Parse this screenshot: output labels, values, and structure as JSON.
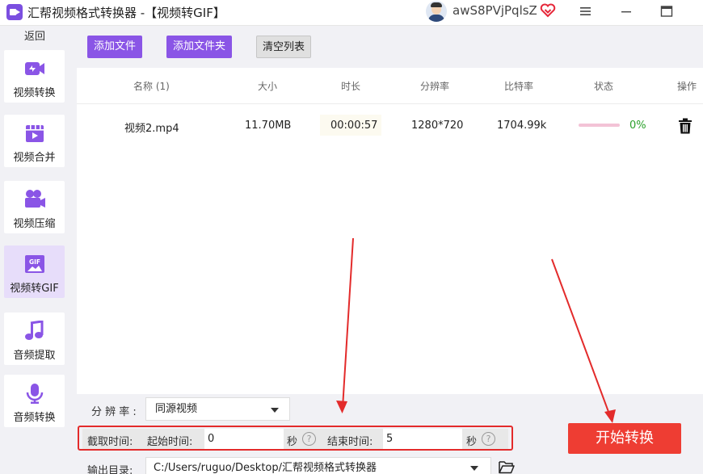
{
  "titlebar": {
    "title": "汇帮视频格式转换器  -【视频转GIF】",
    "username": "awS8PVjPqlsZ"
  },
  "sidebar": {
    "back_label": "返回",
    "items": [
      {
        "label": "视频转换",
        "icon": "video-convert-icon"
      },
      {
        "label": "视频合并",
        "icon": "video-merge-icon"
      },
      {
        "label": "视频压缩",
        "icon": "video-compress-icon"
      },
      {
        "label": "视频转GIF",
        "icon": "gif-icon",
        "active": true
      },
      {
        "label": "音频提取",
        "icon": "music-note-icon"
      },
      {
        "label": "音频转换",
        "icon": "microphone-icon"
      }
    ]
  },
  "toolbar": {
    "add_file": "添加文件",
    "add_folder": "添加文件夹",
    "clear_list": "清空列表"
  },
  "table": {
    "headers": [
      "名称 (1)",
      "大小",
      "时长",
      "分辨率",
      "比特率",
      "状态",
      "操作"
    ],
    "rows": [
      {
        "name": "视频2.mp4",
        "size": "11.70MB",
        "duration": "00:00:57",
        "resolution": "1280*720",
        "bitrate": "1704.99k",
        "status": "0%",
        "progress": 0
      }
    ]
  },
  "settings": {
    "resolution_label": "分 辨 率 :",
    "resolution_value": "同源视频",
    "clip_label": "截取时间:",
    "start_label": "起始时间:",
    "start_value": "0",
    "end_label": "结束时间:",
    "end_value": "5",
    "unit": "秒",
    "help_glyph": "?",
    "output_label": "输出目录:",
    "output_path": "C:/Users/ruguo/Desktop/汇帮视频格式转换器"
  },
  "start_button": "开始转换",
  "colors": {
    "accent": "#8a55e6",
    "start": "#ee3d33",
    "annotation": "#e32b2b",
    "success": "#2aa02a"
  }
}
